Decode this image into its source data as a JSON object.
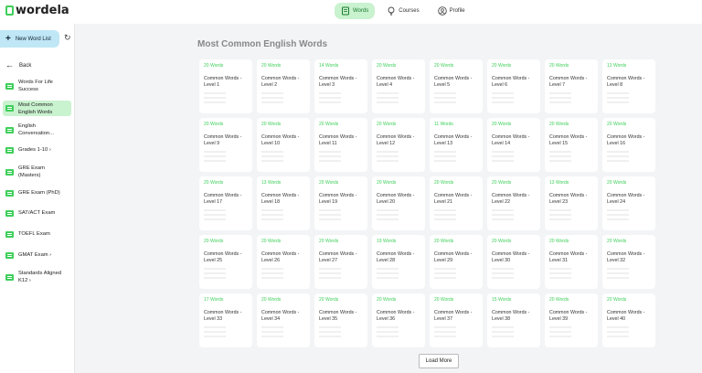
{
  "app": {
    "logo_text": "wordela"
  },
  "nav": {
    "items": [
      {
        "label": "Words",
        "icon": "book-icon",
        "active": true
      },
      {
        "label": "Courses",
        "icon": "lightbulb-icon",
        "active": false
      },
      {
        "label": "Profile",
        "icon": "user-icon",
        "active": false
      }
    ]
  },
  "sidebar": {
    "new_list_label": "New Word List",
    "back_label": "Back",
    "items": [
      {
        "label": "Words For Life Success"
      },
      {
        "label": "Most Common English Words"
      },
      {
        "label": "English Conversation..."
      },
      {
        "label": "Grades 1-10 ›"
      },
      {
        "label": "GRE Exam (Masters)"
      },
      {
        "label": "GRE Exam (PhD)"
      },
      {
        "label": "SAT/ACT Exam"
      },
      {
        "label": "TOEFL Exam"
      },
      {
        "label": "GMAT Exam ›"
      },
      {
        "label": "Standards Aligned K12 ›"
      }
    ]
  },
  "main": {
    "title": "Most Common English Words",
    "cards": [
      {
        "count": "20 Words",
        "title": "Common Words - Level 1"
      },
      {
        "count": "20 Words",
        "title": "Common Words - Level 2"
      },
      {
        "count": "14 Words",
        "title": "Common Words - Level 3"
      },
      {
        "count": "20 Words",
        "title": "Common Words - Level 4"
      },
      {
        "count": "20 Words",
        "title": "Common Words - Level 5"
      },
      {
        "count": "20 Words",
        "title": "Common Words - Level 6"
      },
      {
        "count": "20 Words",
        "title": "Common Words - Level 7"
      },
      {
        "count": "13 Words",
        "title": "Common Words - Level 8"
      },
      {
        "count": "20 Words",
        "title": "Common Words - Level 9"
      },
      {
        "count": "20 Words",
        "title": "Common Words - Level 10"
      },
      {
        "count": "20 Words",
        "title": "Common Words - Level 11"
      },
      {
        "count": "20 Words",
        "title": "Common Words - Level 12"
      },
      {
        "count": "11 Words",
        "title": "Common Words - Level 13"
      },
      {
        "count": "20 Words",
        "title": "Common Words - Level 14"
      },
      {
        "count": "20 Words",
        "title": "Common Words - Level 15"
      },
      {
        "count": "20 Words",
        "title": "Common Words - Level 16"
      },
      {
        "count": "20 Words",
        "title": "Common Words - Level 17"
      },
      {
        "count": "13 Words",
        "title": "Common Words - Level 18"
      },
      {
        "count": "20 Words",
        "title": "Common Words - Level 19"
      },
      {
        "count": "20 Words",
        "title": "Common Words - Level 20"
      },
      {
        "count": "20 Words",
        "title": "Common Words - Level 21"
      },
      {
        "count": "20 Words",
        "title": "Common Words - Level 22"
      },
      {
        "count": "13 Words",
        "title": "Common Words - Level 23"
      },
      {
        "count": "20 Words",
        "title": "Common Words - Level 24"
      },
      {
        "count": "20 Words",
        "title": "Common Words - Level 25"
      },
      {
        "count": "20 Words",
        "title": "Common Words - Level 26"
      },
      {
        "count": "20 Words",
        "title": "Common Words - Level 27"
      },
      {
        "count": "19 Words",
        "title": "Common Words - Level 28"
      },
      {
        "count": "20 Words",
        "title": "Common Words - Level 29"
      },
      {
        "count": "20 Words",
        "title": "Common Words - Level 30"
      },
      {
        "count": "20 Words",
        "title": "Common Words - Level 31"
      },
      {
        "count": "20 Words",
        "title": "Common Words - Level 32"
      },
      {
        "count": "17 Words",
        "title": "Common Words - Level 33"
      },
      {
        "count": "20 Words",
        "title": "Common Words - Level 34"
      },
      {
        "count": "20 Words",
        "title": "Common Words - Level 35"
      },
      {
        "count": "20 Words",
        "title": "Common Words - Level 36"
      },
      {
        "count": "20 Words",
        "title": "Common Words - Level 37"
      },
      {
        "count": "15 Words",
        "title": "Common Words - Level 38"
      },
      {
        "count": "20 Words",
        "title": "Common Words - Level 39"
      },
      {
        "count": "20 Words",
        "title": "Common Words - Level 40"
      }
    ],
    "load_more_label": "Load More"
  },
  "colors": {
    "accent": "#3ecf5a",
    "active_bg": "#c9f2cf",
    "new_list_bg": "#bfe7f5",
    "background": "#f3f4f6"
  }
}
